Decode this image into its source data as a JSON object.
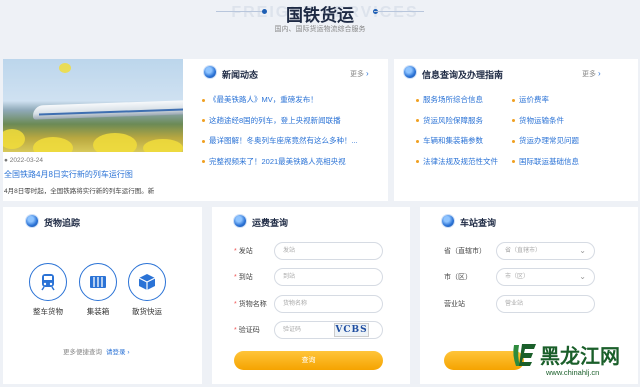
{
  "header": {
    "watermark": "FREIGHT SERVICES",
    "title": "国铁货运",
    "subtitle": "国内、国际货运物流综合服务"
  },
  "news": {
    "title": "新闻动态",
    "more_label": "更多",
    "featured": {
      "date": "2022-03-24",
      "headline": "全国铁路4月8日实行新的列车运行图",
      "excerpt": "4月8日零时起，全国铁路将实行新的列车运行图。新"
    },
    "items": [
      "《最美铁路人》MV，重磅发布！",
      "这趟途经8国的列车，登上央视新闻联播",
      "最详图解！冬奥列车座席竟然有这么多种！...",
      "完整视频来了！2021最美铁路人亮相央视"
    ]
  },
  "info": {
    "title": "信息查询及办理指南",
    "more_label": "更多",
    "left": [
      "服务场所综合信息",
      "货运风险保障服务",
      "车辆和集装箱参数",
      "法律法规及规范性文件"
    ],
    "right": [
      "运价费率",
      "货物运输条件",
      "货运办理常见问题",
      "国际联运基础信息"
    ]
  },
  "tracking": {
    "title": "货物追踪",
    "items": [
      {
        "label": "整车货物",
        "icon": "train-icon"
      },
      {
        "label": "集装箱",
        "icon": "container-icon"
      },
      {
        "label": "散货快运",
        "icon": "package-icon"
      }
    ],
    "more_text": "更多便捷查询",
    "login_label": "请登录"
  },
  "freight": {
    "title": "运费查询",
    "fields": [
      {
        "label": "发站",
        "placeholder": "发站"
      },
      {
        "label": "到站",
        "placeholder": "到站"
      },
      {
        "label": "货物名称",
        "placeholder": "货物名称"
      },
      {
        "label": "验证码",
        "placeholder": "验证码"
      }
    ],
    "captcha": "VCBS",
    "button": "查询"
  },
  "station": {
    "title": "车站查询",
    "fields": [
      {
        "label": "省（直辖市）",
        "placeholder": "省（直辖市）"
      },
      {
        "label": "市（区）",
        "placeholder": "市（区）"
      },
      {
        "label": "营业站",
        "placeholder": "营业站"
      }
    ]
  },
  "logo": {
    "brand": "黑龙江网",
    "url": "www.chinahlj.cn"
  },
  "colors": {
    "accent": "#2b73d6",
    "button": "#f5a300",
    "bullet": "#f0a020",
    "background": "#eef1f6"
  }
}
